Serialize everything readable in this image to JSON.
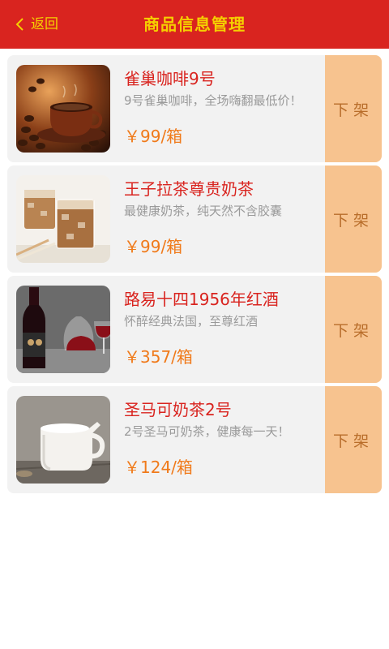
{
  "header": {
    "back_label": "返回",
    "title": "商品信息管理",
    "icon": "chevron-left-icon",
    "bar_color": "#d9241f",
    "text_color": "#f5d000"
  },
  "products": [
    {
      "name": "雀巢咖啡9号",
      "desc": "9号雀巢咖啡，全场嗨翻最低价！",
      "price": "￥99/箱",
      "action": "下架",
      "image": "coffee-cup"
    },
    {
      "name": "王子拉茶尊贵奶茶",
      "desc": "最健康奶茶，纯天然不含胶囊",
      "price": "￥99/箱",
      "action": "下架",
      "image": "iced-milk-tea"
    },
    {
      "name": "路易十四1956年红酒",
      "desc": "怀醉经典法国，至尊红酒",
      "price": "￥357/箱",
      "action": "下架",
      "image": "red-wine"
    },
    {
      "name": "圣马可奶茶2号",
      "desc": "2号圣马可奶茶，健康每一天！",
      "price": "￥124/箱",
      "action": "下架",
      "image": "milk-pitcher"
    }
  ],
  "colors": {
    "name": "#d9241f",
    "price": "#f07a1a",
    "action_bg": "#f7c38f",
    "action_text": "#b86d2a",
    "card_bg": "#f2f2f2"
  }
}
